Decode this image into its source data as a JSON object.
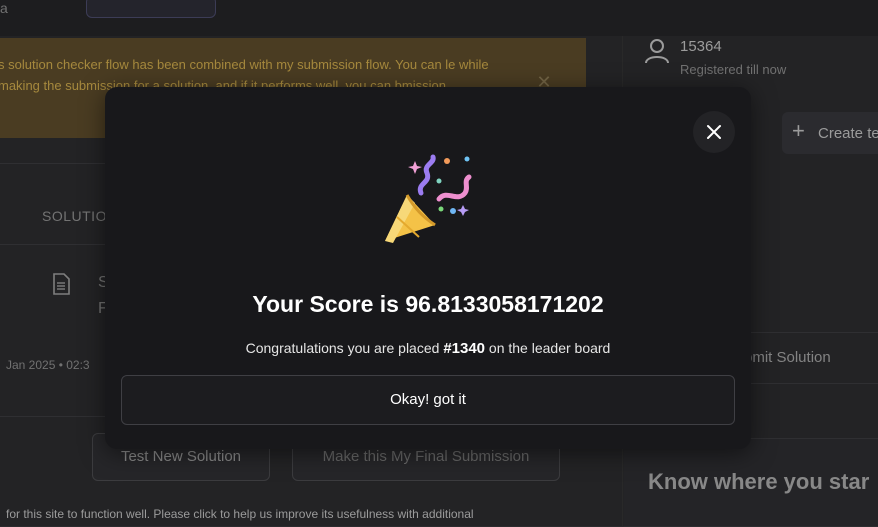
{
  "background": {
    "notice_text": "s solution checker flow has been combined with my submission flow. You can le while making the submission for a solution, and if it performs well, you can bmission",
    "solution_tab_label": "SOLUTIO",
    "submission_initial": "S",
    "submission_initial2": "F",
    "date_text": "Jan 2025 • 02:3",
    "test_button": "Test New Solution",
    "final_button": "Make this My Final Submission",
    "footer_text": "for this site to function well. Please click to help us improve its usefulness with additional",
    "user_id": "15364",
    "user_status": "Registered till now",
    "create_label": "Create te",
    "submit_label": "bmit Solution",
    "know_title": "Know where you star",
    "top_left_char": "a"
  },
  "modal": {
    "icon": "party-popper-icon",
    "score_prefix": "Your Score is ",
    "score_value": "96.8133058171202",
    "congrats_before": "Congratulations you are placed ",
    "rank": "#1340",
    "congrats_after": " on the leader board",
    "ok_label": "Okay! got it"
  },
  "colors": {
    "modal_bg": "#18181b",
    "notice_bg": "#5b4a2a",
    "notice_text": "#caa74b"
  }
}
